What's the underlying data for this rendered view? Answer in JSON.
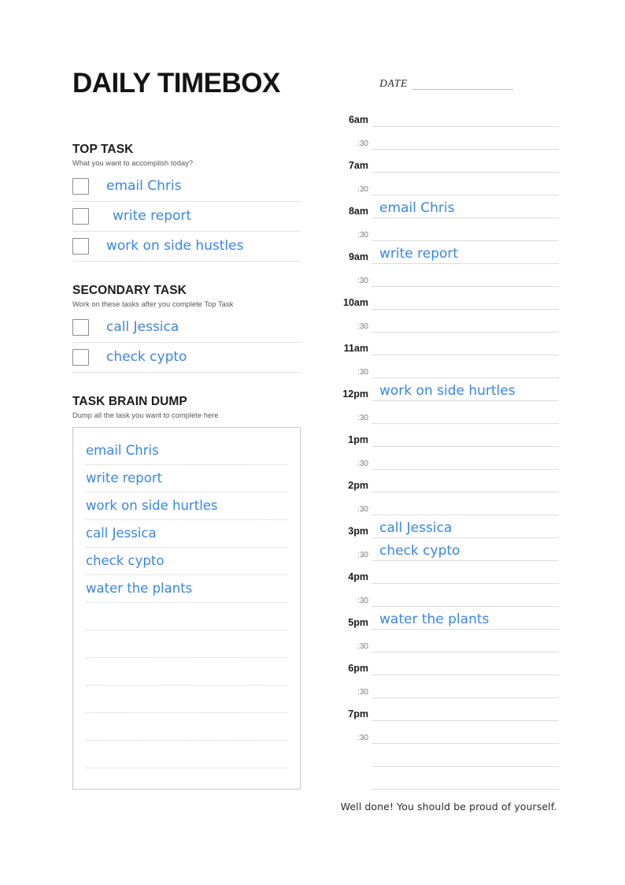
{
  "page": {
    "title": "DAILY TIMEBOX",
    "ink_color": "#3a86e0",
    "closing_note": "Well done! You should be proud of yourself."
  },
  "date_field": {
    "label": "DATE",
    "value": ""
  },
  "top_task": {
    "heading": "TOP TASK",
    "subtitle": "What you want to accomplish today?",
    "items": [
      {
        "text": "email Chris",
        "checked": false
      },
      {
        "text": "write report",
        "checked": false
      },
      {
        "text": "work on side hustles",
        "checked": false
      }
    ]
  },
  "secondary_task": {
    "heading": "SECONDARY TASK",
    "subtitle": "Work on these tasks after you complete Top Task",
    "items": [
      {
        "text": "call Jessica",
        "checked": false
      },
      {
        "text": "check cypto",
        "checked": false
      }
    ]
  },
  "brain_dump": {
    "heading": "TASK BRAIN DUMP",
    "subtitle": "Dump all the task you want to complete here",
    "lines": [
      "email Chris",
      "write report",
      "work on side hurtles",
      "call Jessica",
      "check cypto",
      "water the plants",
      "",
      "",
      "",
      "",
      "",
      ""
    ]
  },
  "schedule": {
    "rows": [
      {
        "label": "6am",
        "type": "hour",
        "entry": ""
      },
      {
        "label": ":30",
        "type": "half",
        "entry": ""
      },
      {
        "label": "7am",
        "type": "hour",
        "entry": ""
      },
      {
        "label": ":30",
        "type": "half",
        "entry": ""
      },
      {
        "label": "8am",
        "type": "hour",
        "entry": "email Chris"
      },
      {
        "label": ":30",
        "type": "half",
        "entry": ""
      },
      {
        "label": "9am",
        "type": "hour",
        "entry": "write report"
      },
      {
        "label": ":30",
        "type": "half",
        "entry": ""
      },
      {
        "label": "10am",
        "type": "hour",
        "entry": ""
      },
      {
        "label": ":30",
        "type": "half",
        "entry": ""
      },
      {
        "label": "11am",
        "type": "hour",
        "entry": ""
      },
      {
        "label": ":30",
        "type": "half",
        "entry": ""
      },
      {
        "label": "12pm",
        "type": "hour",
        "entry": "work on side hurtles"
      },
      {
        "label": ":30",
        "type": "half",
        "entry": ""
      },
      {
        "label": "1pm",
        "type": "hour",
        "entry": ""
      },
      {
        "label": ":30",
        "type": "half",
        "entry": ""
      },
      {
        "label": "2pm",
        "type": "hour",
        "entry": ""
      },
      {
        "label": ":30",
        "type": "half",
        "entry": ""
      },
      {
        "label": "3pm",
        "type": "hour",
        "entry": "call Jessica"
      },
      {
        "label": ":30",
        "type": "half",
        "entry": "check cypto"
      },
      {
        "label": "4pm",
        "type": "hour",
        "entry": ""
      },
      {
        "label": ":30",
        "type": "half",
        "entry": ""
      },
      {
        "label": "5pm",
        "type": "hour",
        "entry": "water the plants"
      },
      {
        "label": ":30",
        "type": "half",
        "entry": ""
      },
      {
        "label": "6pm",
        "type": "hour",
        "entry": ""
      },
      {
        "label": ":30",
        "type": "half",
        "entry": ""
      },
      {
        "label": "7pm",
        "type": "hour",
        "entry": ""
      },
      {
        "label": ":30",
        "type": "half",
        "entry": ""
      },
      {
        "label": "",
        "type": "blank",
        "entry": ""
      },
      {
        "label": "",
        "type": "blank",
        "entry": ""
      }
    ]
  }
}
